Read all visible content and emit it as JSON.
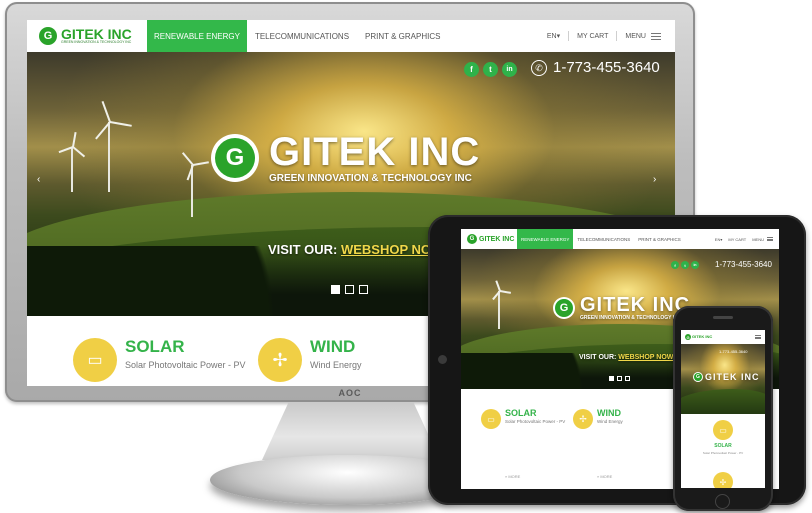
{
  "site": {
    "logo_name": "GITEK INC",
    "logo_tag": "GREEN INNOVATION & TECHNOLOGY INC",
    "logo_letter": "G",
    "nav": [
      "RENEWABLE ENERGY",
      "TELECOMMUNICATIONS",
      "PRINT & GRAPHICS"
    ],
    "lang": "EN▾",
    "cart": "MY CART",
    "menu": "MENU",
    "social": [
      "f",
      "t",
      "in"
    ],
    "phone": "1-773-455-3640",
    "hero_title": "GITEK INC",
    "hero_sub": "GREEN INNOVATION & TECHNOLOGY INC",
    "visit_prefix": "VISIT OUR:",
    "visit_link": "WEBSHOP NOW!",
    "features": [
      {
        "title": "SOLAR",
        "sub": "Solar Photovoltaic Power - PV",
        "icon": "solar-panel-icon"
      },
      {
        "title": "WIND",
        "sub": "Wind Energy",
        "icon": "wind-turbine-icon"
      }
    ],
    "more": "» MORE"
  },
  "monitor": {
    "brand": "AOC"
  },
  "colors": {
    "brand_green": "#33b84a",
    "accent_yellow": "#f0cf45",
    "link_yellow": "#f1d84a"
  }
}
